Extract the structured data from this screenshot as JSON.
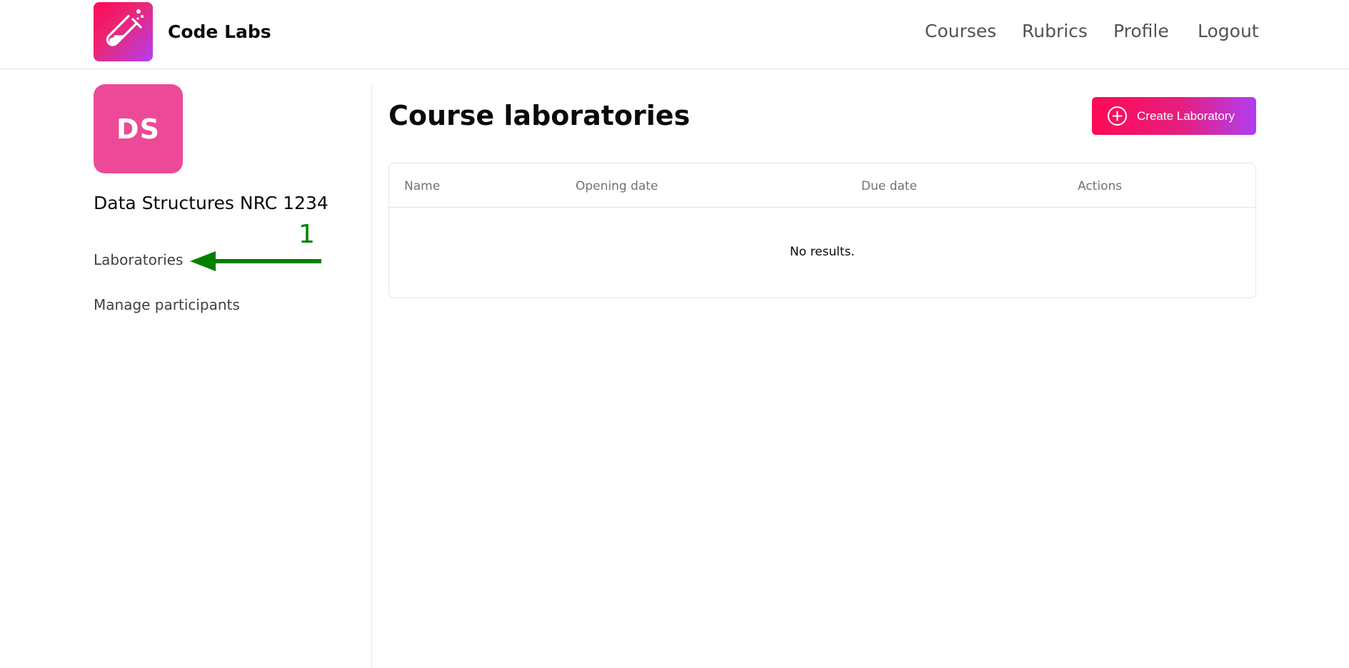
{
  "header": {
    "brand": "Code Labs",
    "logo_icon": "test-tube-icon",
    "nav": [
      {
        "label": "Courses"
      },
      {
        "label": "Rubrics"
      },
      {
        "label": "Profile"
      },
      {
        "label": "Logout"
      }
    ]
  },
  "sidebar": {
    "avatar_initials": "DS",
    "course_name": "Data Structures NRC 1234",
    "links": [
      {
        "label": "Laboratories"
      },
      {
        "label": "Manage participants"
      }
    ],
    "annotation": {
      "number": "1",
      "color": "#008000",
      "icon": "arrow-left-icon"
    }
  },
  "main": {
    "title": "Course laboratories",
    "create_button": {
      "label": "Create Laboratory",
      "icon": "plus-circle-icon"
    },
    "table": {
      "columns": [
        "Name",
        "Opening date",
        "Due date",
        "Actions"
      ],
      "rows": [],
      "empty_text": "No results."
    }
  },
  "colors": {
    "accent_start": "#ff0a54",
    "accent_end": "#b13ef2",
    "avatar": "#ec4a98",
    "annotation": "#008000"
  }
}
